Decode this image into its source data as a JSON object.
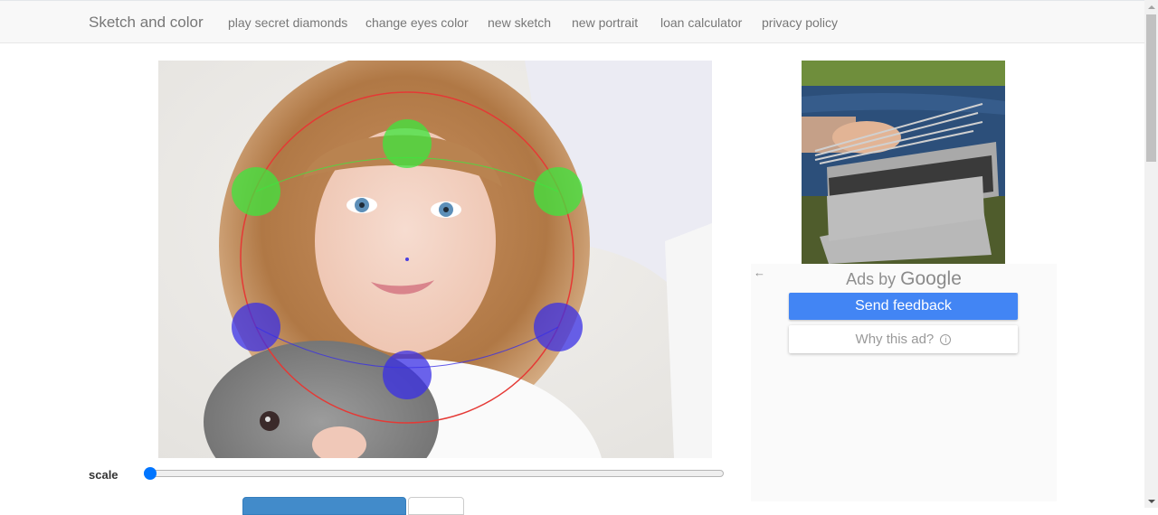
{
  "navbar": {
    "brand": "Sketch and color",
    "links": [
      "play secret diamonds",
      "change eyes color",
      "new sketch",
      "new portrait",
      "loan calculator",
      "privacy policy"
    ]
  },
  "editor": {
    "photo_description": "Girl with blue eyes holding a grey rabbit",
    "overlay_colors": {
      "face_circle": "#e53935",
      "top_handles": "#3ee63e",
      "bottom_handles": "#3a2fe6",
      "center_point": "#4a3fe0"
    },
    "scale_label": "scale",
    "scale_value_fraction": 0
  },
  "ad": {
    "image_description": "Portable stainless steel grill with skewers by a river",
    "back_icon": "←",
    "ads_by": "Ads by",
    "google": "Google",
    "send_feedback": "Send feedback",
    "why_this_ad": "Why this ad?",
    "info_icon": "i"
  },
  "scrollbar": {
    "up_icon": "scroll-up-arrow",
    "down_icon": "scroll-down-arrow"
  }
}
